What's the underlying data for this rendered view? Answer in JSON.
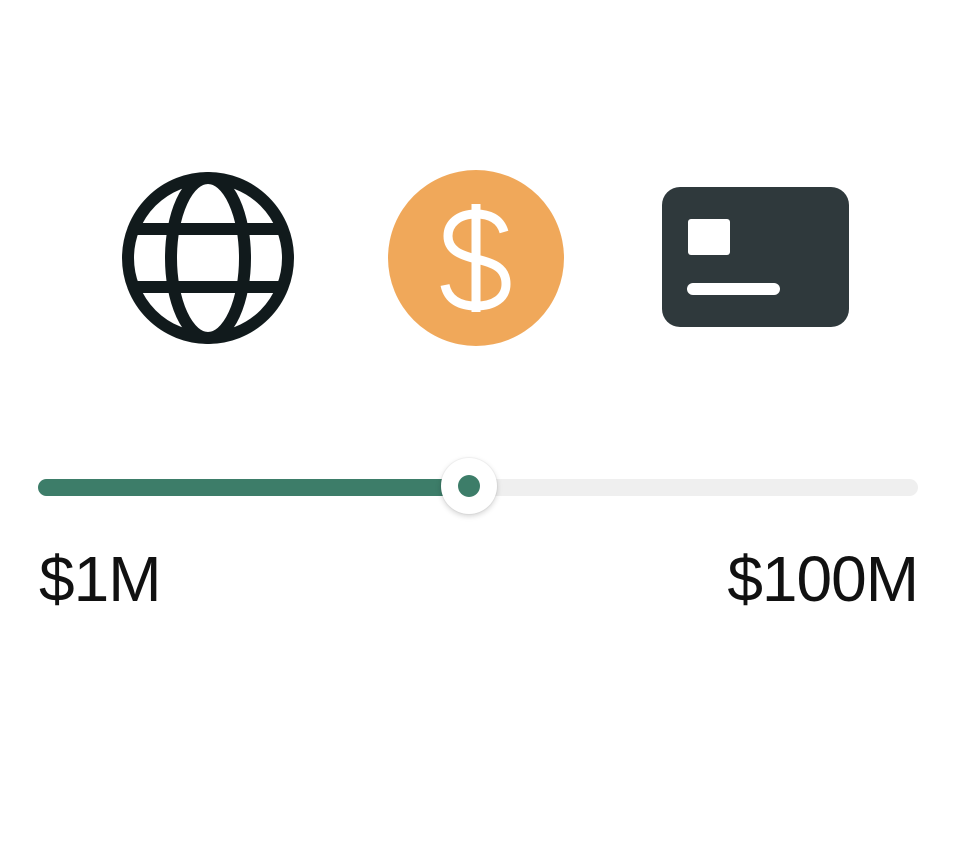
{
  "icons": [
    "globe-icon",
    "dollar-icon",
    "id-card-icon"
  ],
  "colors": {
    "accent": "#3d7d69",
    "track": "#efefef",
    "dollar_circle": "#f0a85a",
    "card": "#2f393c",
    "globe": "#111a1c"
  },
  "slider": {
    "min_label": "$1M",
    "max_label": "$100M",
    "value_fraction": 0.49
  }
}
